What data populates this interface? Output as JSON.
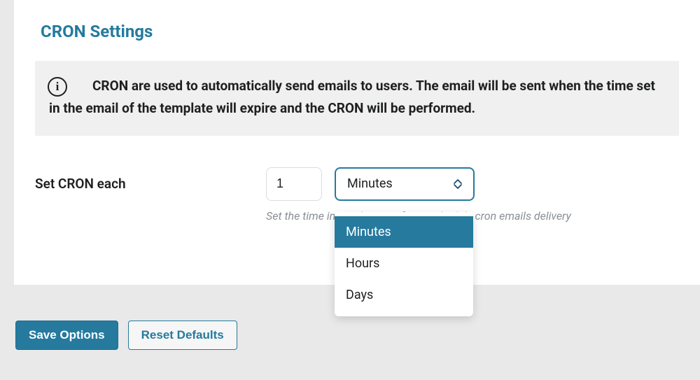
{
  "section": {
    "title": "CRON Settings",
    "info": "CRON are used to automatically send emails to users. The email will be sent when the time set in the email of the template will expire and the CRON will be performed."
  },
  "form": {
    "label": "Set CRON each",
    "value": "1",
    "unit_selected": "Minutes",
    "unit_options": [
      "Minutes",
      "Hours",
      "Days"
    ],
    "help": "Set the time interval you prefer to schedule cron emails delivery"
  },
  "actions": {
    "save": "Save Options",
    "reset": "Reset Defaults"
  },
  "colors": {
    "accent": "#257a9e"
  }
}
